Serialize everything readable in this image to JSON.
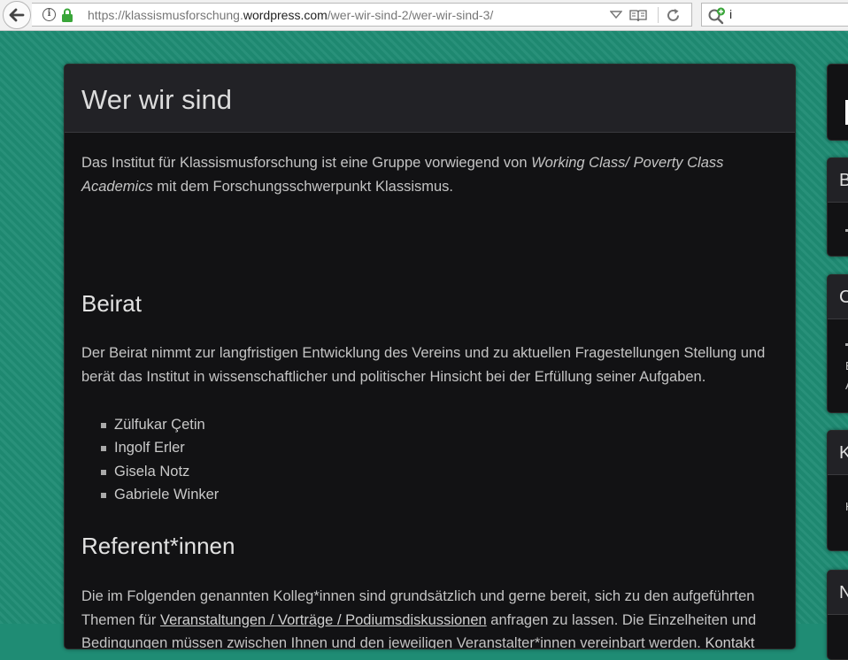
{
  "browser": {
    "url_prefix": "https://klassismusforschung.",
    "url_host": "wordpress.com",
    "url_path": "/wer-wir-sind-2/wer-wir-sind-3/",
    "search_value": "i",
    "icons": [
      "back-arrow-icon",
      "info-icon",
      "lock-icon",
      "dropdown-arrow-icon",
      "reader-view-icon",
      "reload-icon",
      "search-add-icon"
    ],
    "accent": "#3b7fd8"
  },
  "page": {
    "title": "Wer wir sind",
    "intro": {
      "before": "Das Institut für Klassismusforschung ist eine Gruppe vorwiegend von ",
      "emph": "Working Class/ Poverty Class Academics",
      "after": " mit dem Forschungsschwerpunkt Klassismus."
    },
    "beirat": {
      "heading": "Beirat",
      "text": "Der Beirat nimmt zur langfristigen Entwicklung des Vereins und zu aktuellen Fragestellungen Stellung und berät das Institut in wissenschaftlicher und politischer Hinsicht bei der Erfüllung seiner Aufgaben.",
      "members": [
        "Zülfukar Çetin",
        "Ingolf Erler",
        "Gisela Notz",
        "Gabriele Winker"
      ]
    },
    "referenten": {
      "heading": "Referent*innen",
      "text_before": "Die im Folgenden genannten Kolleg*innen sind grundsätzlich und gerne bereit, sich zu den aufgeführten Themen für ",
      "link1": "Veranstaltungen / Vorträge / Podiumsdiskussionen",
      "text_middle": " anfragen zu lassen. Die Einzelheiten und Bedingungen müssen zwischen Ihnen und den jeweiligen Veranstalter*innen vereinbart werden. ",
      "link2": "Kontakt"
    },
    "colors": {
      "background": "#1f8c74",
      "panel": "#121214",
      "panel_head": "#222226",
      "text": "#c4c4c4"
    }
  },
  "sidebar": {
    "widgets": [
      {
        "heading": ""
      },
      {
        "heading": "B"
      },
      {
        "heading": "C",
        "lines": [
          "E",
          "A"
        ]
      },
      {
        "heading": "K",
        "lines": [
          "H"
        ]
      },
      {
        "heading": "N"
      }
    ]
  }
}
